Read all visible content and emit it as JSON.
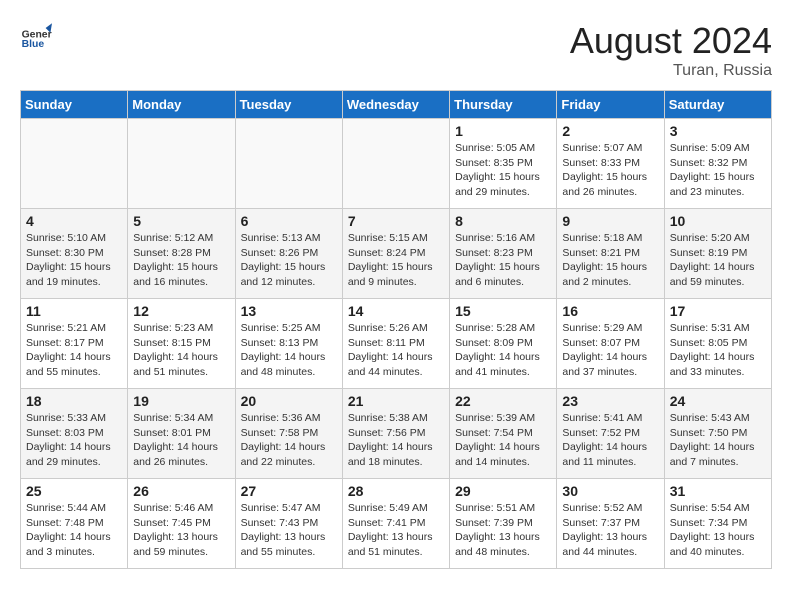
{
  "header": {
    "logo_general": "General",
    "logo_blue": "Blue",
    "month_year": "August 2024",
    "location": "Turan, Russia"
  },
  "weekdays": [
    "Sunday",
    "Monday",
    "Tuesday",
    "Wednesday",
    "Thursday",
    "Friday",
    "Saturday"
  ],
  "weeks": [
    {
      "days": [
        {
          "num": "",
          "info": ""
        },
        {
          "num": "",
          "info": ""
        },
        {
          "num": "",
          "info": ""
        },
        {
          "num": "",
          "info": ""
        },
        {
          "num": "1",
          "info": "Sunrise: 5:05 AM\nSunset: 8:35 PM\nDaylight: 15 hours\nand 29 minutes."
        },
        {
          "num": "2",
          "info": "Sunrise: 5:07 AM\nSunset: 8:33 PM\nDaylight: 15 hours\nand 26 minutes."
        },
        {
          "num": "3",
          "info": "Sunrise: 5:09 AM\nSunset: 8:32 PM\nDaylight: 15 hours\nand 23 minutes."
        }
      ]
    },
    {
      "days": [
        {
          "num": "4",
          "info": "Sunrise: 5:10 AM\nSunset: 8:30 PM\nDaylight: 15 hours\nand 19 minutes."
        },
        {
          "num": "5",
          "info": "Sunrise: 5:12 AM\nSunset: 8:28 PM\nDaylight: 15 hours\nand 16 minutes."
        },
        {
          "num": "6",
          "info": "Sunrise: 5:13 AM\nSunset: 8:26 PM\nDaylight: 15 hours\nand 12 minutes."
        },
        {
          "num": "7",
          "info": "Sunrise: 5:15 AM\nSunset: 8:24 PM\nDaylight: 15 hours\nand 9 minutes."
        },
        {
          "num": "8",
          "info": "Sunrise: 5:16 AM\nSunset: 8:23 PM\nDaylight: 15 hours\nand 6 minutes."
        },
        {
          "num": "9",
          "info": "Sunrise: 5:18 AM\nSunset: 8:21 PM\nDaylight: 15 hours\nand 2 minutes."
        },
        {
          "num": "10",
          "info": "Sunrise: 5:20 AM\nSunset: 8:19 PM\nDaylight: 14 hours\nand 59 minutes."
        }
      ]
    },
    {
      "days": [
        {
          "num": "11",
          "info": "Sunrise: 5:21 AM\nSunset: 8:17 PM\nDaylight: 14 hours\nand 55 minutes."
        },
        {
          "num": "12",
          "info": "Sunrise: 5:23 AM\nSunset: 8:15 PM\nDaylight: 14 hours\nand 51 minutes."
        },
        {
          "num": "13",
          "info": "Sunrise: 5:25 AM\nSunset: 8:13 PM\nDaylight: 14 hours\nand 48 minutes."
        },
        {
          "num": "14",
          "info": "Sunrise: 5:26 AM\nSunset: 8:11 PM\nDaylight: 14 hours\nand 44 minutes."
        },
        {
          "num": "15",
          "info": "Sunrise: 5:28 AM\nSunset: 8:09 PM\nDaylight: 14 hours\nand 41 minutes."
        },
        {
          "num": "16",
          "info": "Sunrise: 5:29 AM\nSunset: 8:07 PM\nDaylight: 14 hours\nand 37 minutes."
        },
        {
          "num": "17",
          "info": "Sunrise: 5:31 AM\nSunset: 8:05 PM\nDaylight: 14 hours\nand 33 minutes."
        }
      ]
    },
    {
      "days": [
        {
          "num": "18",
          "info": "Sunrise: 5:33 AM\nSunset: 8:03 PM\nDaylight: 14 hours\nand 29 minutes."
        },
        {
          "num": "19",
          "info": "Sunrise: 5:34 AM\nSunset: 8:01 PM\nDaylight: 14 hours\nand 26 minutes."
        },
        {
          "num": "20",
          "info": "Sunrise: 5:36 AM\nSunset: 7:58 PM\nDaylight: 14 hours\nand 22 minutes."
        },
        {
          "num": "21",
          "info": "Sunrise: 5:38 AM\nSunset: 7:56 PM\nDaylight: 14 hours\nand 18 minutes."
        },
        {
          "num": "22",
          "info": "Sunrise: 5:39 AM\nSunset: 7:54 PM\nDaylight: 14 hours\nand 14 minutes."
        },
        {
          "num": "23",
          "info": "Sunrise: 5:41 AM\nSunset: 7:52 PM\nDaylight: 14 hours\nand 11 minutes."
        },
        {
          "num": "24",
          "info": "Sunrise: 5:43 AM\nSunset: 7:50 PM\nDaylight: 14 hours\nand 7 minutes."
        }
      ]
    },
    {
      "days": [
        {
          "num": "25",
          "info": "Sunrise: 5:44 AM\nSunset: 7:48 PM\nDaylight: 14 hours\nand 3 minutes."
        },
        {
          "num": "26",
          "info": "Sunrise: 5:46 AM\nSunset: 7:45 PM\nDaylight: 13 hours\nand 59 minutes."
        },
        {
          "num": "27",
          "info": "Sunrise: 5:47 AM\nSunset: 7:43 PM\nDaylight: 13 hours\nand 55 minutes."
        },
        {
          "num": "28",
          "info": "Sunrise: 5:49 AM\nSunset: 7:41 PM\nDaylight: 13 hours\nand 51 minutes."
        },
        {
          "num": "29",
          "info": "Sunrise: 5:51 AM\nSunset: 7:39 PM\nDaylight: 13 hours\nand 48 minutes."
        },
        {
          "num": "30",
          "info": "Sunrise: 5:52 AM\nSunset: 7:37 PM\nDaylight: 13 hours\nand 44 minutes."
        },
        {
          "num": "31",
          "info": "Sunrise: 5:54 AM\nSunset: 7:34 PM\nDaylight: 13 hours\nand 40 minutes."
        }
      ]
    }
  ]
}
